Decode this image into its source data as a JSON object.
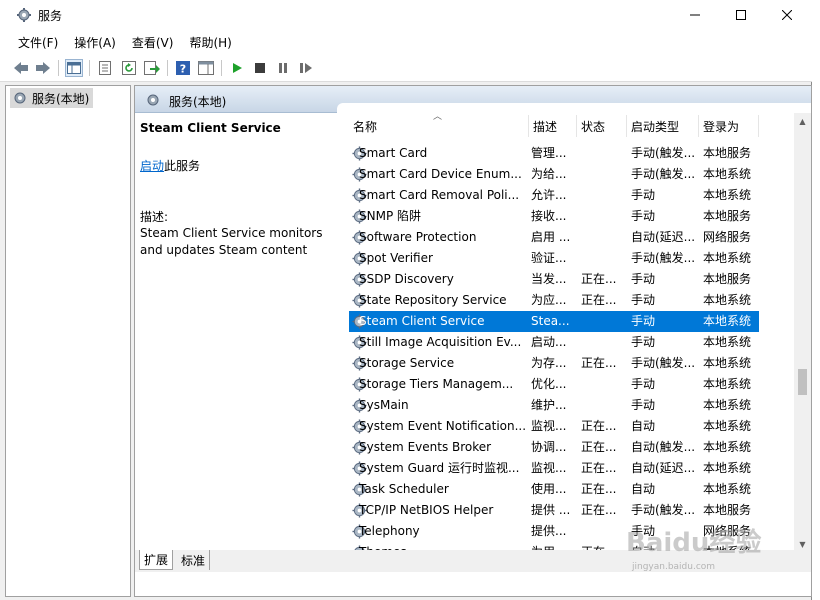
{
  "window": {
    "title": "服务"
  },
  "menu": [
    "文件(F)",
    "操作(A)",
    "查看(V)",
    "帮助(H)"
  ],
  "tree": {
    "item": "服务(本地)"
  },
  "main_header": "服务(本地)",
  "detail": {
    "service_name": "Steam Client Service",
    "start_link": "启动",
    "start_suffix": "此服务",
    "desc_label": "描述:",
    "desc_text": "Steam Client Service monitors and updates Steam content"
  },
  "columns": [
    "名称",
    "描述",
    "状态",
    "启动类型",
    "登录为"
  ],
  "rows": [
    {
      "name": "Smart Card",
      "desc": "管理...",
      "status": "",
      "startup": "手动(触发...",
      "logon": "本地服务"
    },
    {
      "name": "Smart Card Device Enum...",
      "desc": "为给...",
      "status": "",
      "startup": "手动(触发...",
      "logon": "本地系统"
    },
    {
      "name": "Smart Card Removal Poli...",
      "desc": "允许...",
      "status": "",
      "startup": "手动",
      "logon": "本地系统"
    },
    {
      "name": "SNMP 陷阱",
      "desc": "接收...",
      "status": "",
      "startup": "手动",
      "logon": "本地服务"
    },
    {
      "name": "Software Protection",
      "desc": "启用 ...",
      "status": "",
      "startup": "自动(延迟...",
      "logon": "网络服务"
    },
    {
      "name": "Spot Verifier",
      "desc": "验证...",
      "status": "",
      "startup": "手动(触发...",
      "logon": "本地系统"
    },
    {
      "name": "SSDP Discovery",
      "desc": "当发...",
      "status": "正在...",
      "startup": "手动",
      "logon": "本地服务"
    },
    {
      "name": "State Repository Service",
      "desc": "为应...",
      "status": "正在...",
      "startup": "手动",
      "logon": "本地系统"
    },
    {
      "name": "Steam Client Service",
      "desc": "Stea...",
      "status": "",
      "startup": "手动",
      "logon": "本地系统",
      "selected": true
    },
    {
      "name": "Still Image Acquisition Ev...",
      "desc": "启动...",
      "status": "",
      "startup": "手动",
      "logon": "本地系统"
    },
    {
      "name": "Storage Service",
      "desc": "为存...",
      "status": "正在...",
      "startup": "手动(触发...",
      "logon": "本地系统"
    },
    {
      "name": "Storage Tiers Managem...",
      "desc": "优化...",
      "status": "",
      "startup": "手动",
      "logon": "本地系统"
    },
    {
      "name": "SysMain",
      "desc": "维护...",
      "status": "",
      "startup": "手动",
      "logon": "本地系统"
    },
    {
      "name": "System Event Notification...",
      "desc": "监视...",
      "status": "正在...",
      "startup": "自动",
      "logon": "本地系统"
    },
    {
      "name": "System Events Broker",
      "desc": "协调...",
      "status": "正在...",
      "startup": "自动(触发...",
      "logon": "本地系统"
    },
    {
      "name": "System Guard 运行时监视...",
      "desc": "监视...",
      "status": "正在...",
      "startup": "自动(延迟...",
      "logon": "本地系统"
    },
    {
      "name": "Task Scheduler",
      "desc": "使用...",
      "status": "正在...",
      "startup": "自动",
      "logon": "本地系统"
    },
    {
      "name": "TCP/IP NetBIOS Helper",
      "desc": "提供 ...",
      "status": "正在...",
      "startup": "手动(触发...",
      "logon": "本地服务"
    },
    {
      "name": "Telephony",
      "desc": "提供...",
      "status": "",
      "startup": "手动",
      "logon": "网络服务"
    },
    {
      "name": "Themes",
      "desc": "为用...",
      "status": "正在...",
      "startup": "自动",
      "logon": "本地系统"
    }
  ],
  "tabs": [
    "扩展",
    "标准"
  ],
  "watermark": {
    "text": "Baidu经验",
    "url": "jingyan.baidu.com"
  },
  "colors": {
    "selection": "#0078d7",
    "link": "#0066cc",
    "header_gradient": "#c8d6e6"
  }
}
